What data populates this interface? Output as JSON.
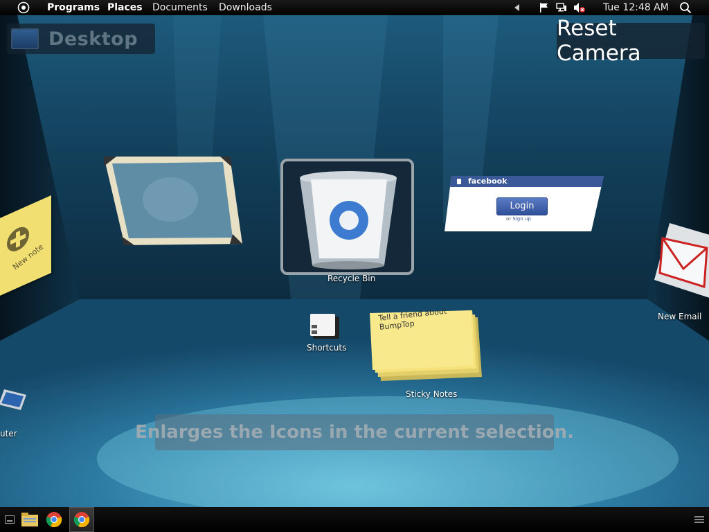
{
  "top_panel": {
    "menus": [
      "Programs",
      "Places",
      "Documents",
      "Downloads"
    ],
    "clock": "Tue 12:48 AM"
  },
  "desktop": {
    "title": "Desktop",
    "reset_camera": "Reset Camera",
    "tooltip": "Enlarges the Icons in the current selection."
  },
  "items": {
    "recycle_bin": "Recycle Bin",
    "shortcuts": "Shortcuts",
    "sticky_notes": "Sticky Notes",
    "sticky_text": "Tell a friend about BumpTop",
    "new_email": "New Email",
    "new_note": "New note",
    "computer": "uter"
  },
  "facebook": {
    "title": "facebook",
    "login": "Login",
    "or": "or",
    "signup": "Sign up"
  },
  "colors": {
    "room_dark": "#0d2a3b",
    "room_light": "#4fa3c4",
    "sticky": "#f2df72",
    "facebook_blue": "#3b5998"
  }
}
